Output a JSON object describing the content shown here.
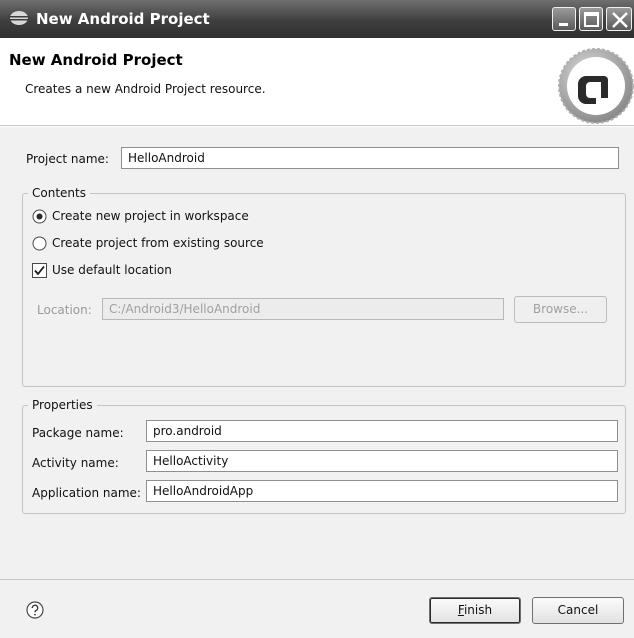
{
  "window": {
    "title": "New Android Project",
    "icon": "eclipse-window-icon",
    "controls": [
      "minimize-icon",
      "maximize-icon",
      "close-icon"
    ]
  },
  "header": {
    "title": "New Android Project",
    "description": "Creates a new Android Project resource.",
    "logo": "android-logo"
  },
  "form": {
    "project_name": {
      "label": "Project name:",
      "value": "HelloAndroid"
    }
  },
  "contents": {
    "legend": "Contents",
    "options": [
      {
        "label": "Create new project in workspace",
        "selected": true
      },
      {
        "label": "Create project from existing source",
        "selected": false
      }
    ],
    "use_default_location": {
      "label": "Use default location",
      "checked": true
    },
    "location": {
      "label": "Location:",
      "value": "C:/Android3/HelloAndroid",
      "enabled": false
    },
    "browse_label": "Browse..."
  },
  "properties": {
    "legend": "Properties",
    "fields": [
      {
        "label": "Package name:",
        "value": "pro.android"
      },
      {
        "label": "Activity name:",
        "value": "HelloActivity"
      },
      {
        "label": "Application name:",
        "value": "HelloAndroidApp"
      }
    ]
  },
  "footer": {
    "help_icon": "help-icon",
    "finish_mnemonic": "F",
    "finish_rest": "inish",
    "cancel_label": "Cancel"
  },
  "colors": {
    "titlebar": "#3e3e3e",
    "dialog_bg": "#f1f1f1",
    "header_bg": "#ffffff"
  }
}
